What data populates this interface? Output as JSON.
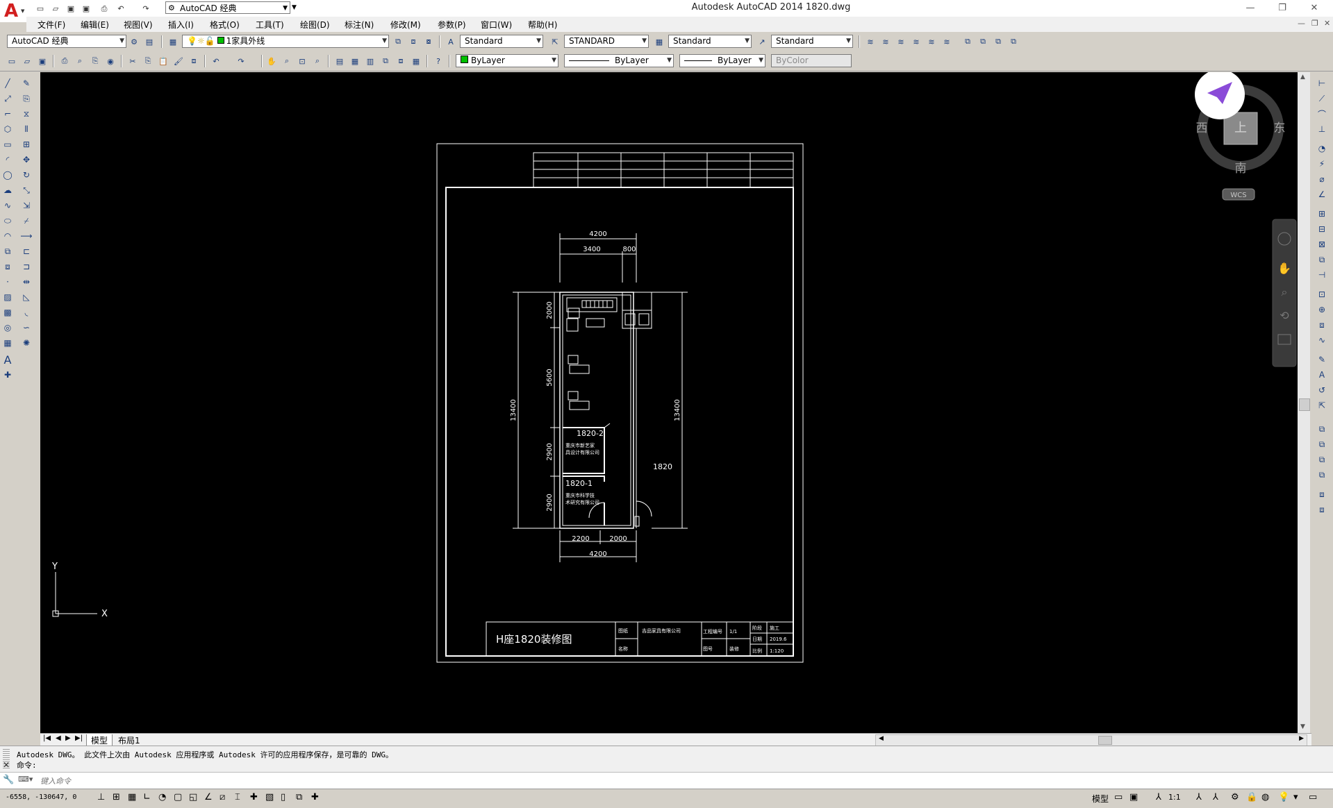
{
  "app": {
    "title": "Autodesk AutoCAD 2014    1820.dwg",
    "logo_letter": "A",
    "workspace": "AutoCAD 经典"
  },
  "menus": [
    "文件(F)",
    "编辑(E)",
    "视图(V)",
    "插入(I)",
    "格式(O)",
    "工具(T)",
    "绘图(D)",
    "标注(N)",
    "修改(M)",
    "参数(P)",
    "窗口(W)",
    "帮助(H)"
  ],
  "toolbar1": {
    "workspace": "AutoCAD 经典",
    "layer": "1家具外线",
    "text_style": "Standard",
    "dim_style": "STANDARD",
    "table_style": "Standard",
    "mleader_style": "Standard"
  },
  "toolbar2": {
    "color": "ByLayer",
    "linetype": "ByLayer",
    "lineweight": "ByLayer",
    "plotstyle": "ByColor"
  },
  "viewcube": {
    "west": "西",
    "east": "东",
    "south": "南",
    "top": "上",
    "wcs": "WCS"
  },
  "ucs": {
    "x": "X",
    "y": "Y"
  },
  "drawing": {
    "title": "H座1820装修图",
    "room": "1820",
    "room1": "1820-1",
    "room2": "1820-2",
    "company1_line1": "重庆市科学技",
    "company1_line2": "术研究有限公司",
    "company2_line1": "重庆市新艺家",
    "company2_line2": "具设计有限公司",
    "dims": {
      "top_total": "4200",
      "top_left": "3400",
      "top_right": "800",
      "bottom_left": "2200",
      "bottom_right": "2000",
      "bottom_total": "4200",
      "left_total": "13400",
      "right_total": "13400",
      "left_1": "2000",
      "left_2": "5600",
      "left_3": "2900",
      "left_4": "2900"
    },
    "titleblock": {
      "label_a": "图纸",
      "label_b": "名称",
      "proj": "吉品家具有限公司",
      "c1": "工程编号",
      "c1v": "1/1",
      "c2": "图号",
      "c2v": "装修",
      "c3": "阶段",
      "c3v": "施工",
      "c4": "日期",
      "c4v": "2019.6",
      "c5": "比例",
      "c5v": "1:120"
    }
  },
  "tabs": {
    "model": "模型",
    "layout1": "布局1"
  },
  "command": {
    "history_line1": "Autodesk DWG。  此文件上次由 Autodesk 应用程序或 Autodesk 许可的应用程序保存，是可靠的 DWG。",
    "history_line2": "命令:",
    "input_placeholder": "键入命令"
  },
  "status": {
    "coords": "-6558, -130647, 0",
    "model": "模型",
    "scale": "1:1"
  }
}
